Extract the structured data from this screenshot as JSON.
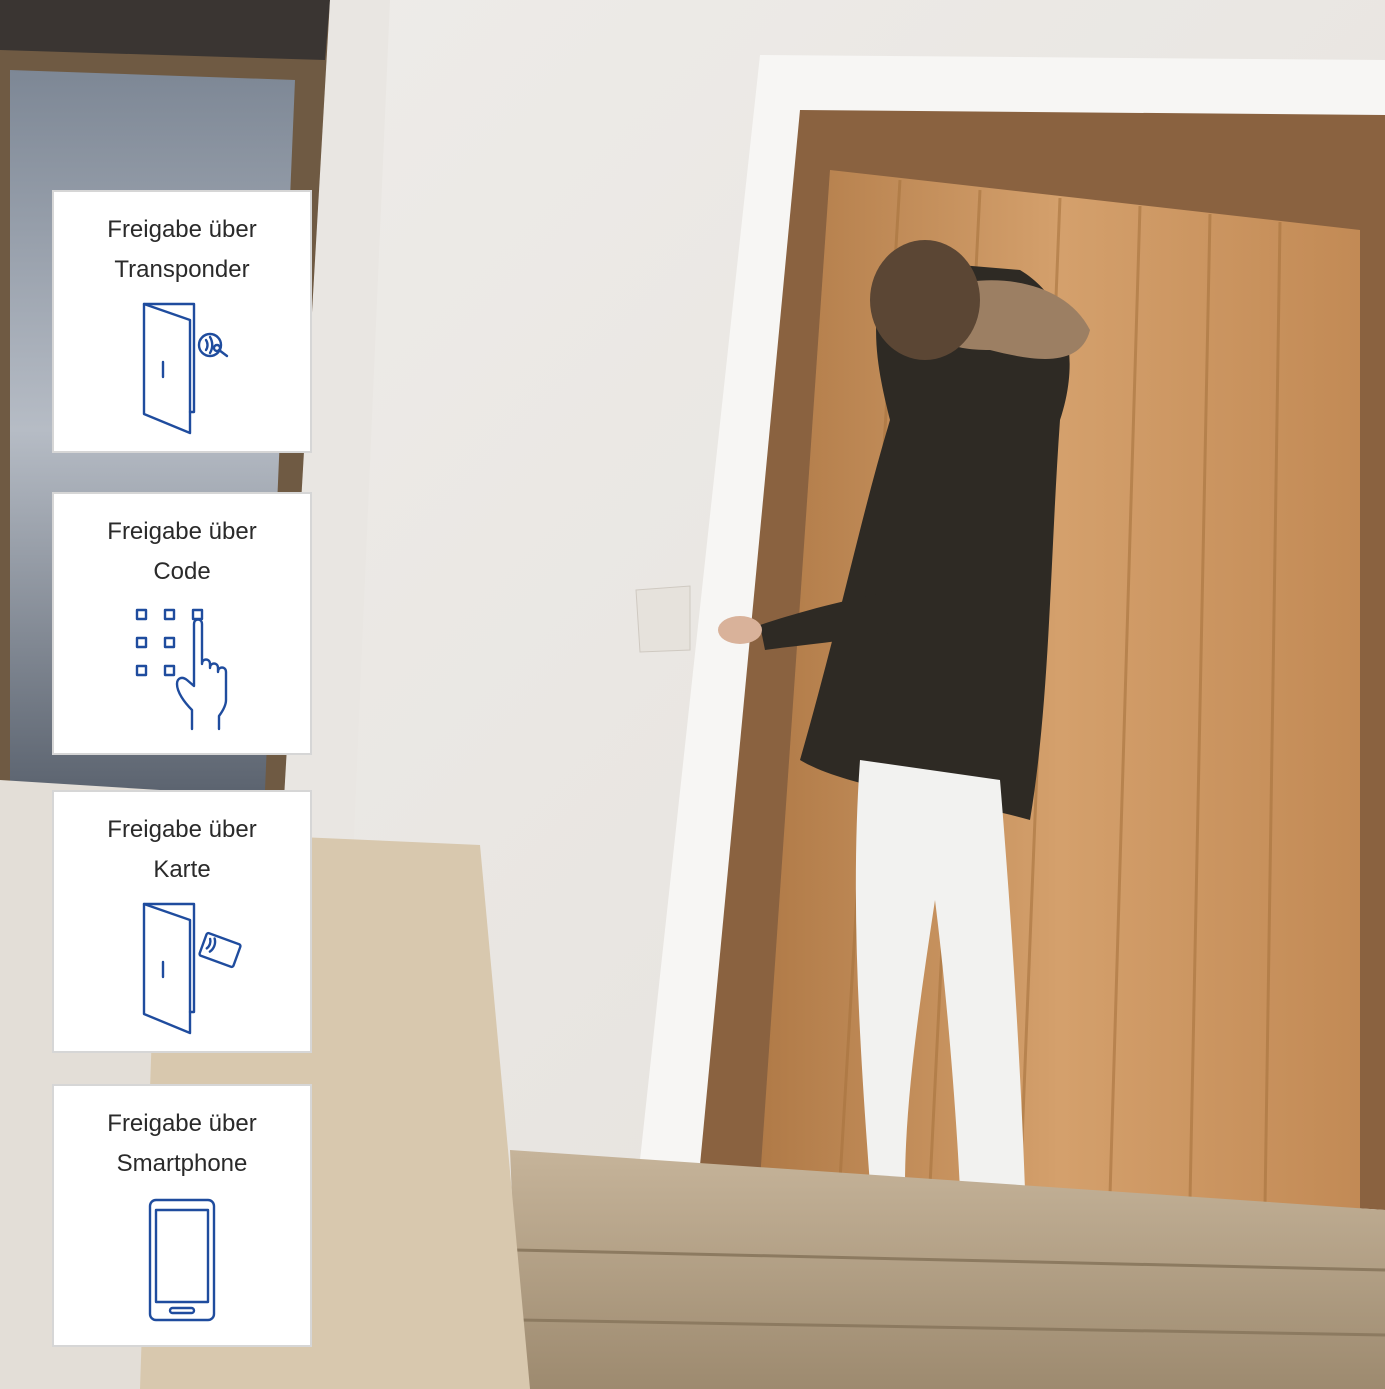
{
  "colors": {
    "icon_blue": "#1f4c9e",
    "card_border": "#d6d6d6",
    "wall": "#ece9e5",
    "door_wood": "#c9955f"
  },
  "cards": [
    {
      "line1": "Freigabe über",
      "line2": "Transponder",
      "icon": "door-transponder-icon"
    },
    {
      "line1": "Freigabe über",
      "line2": "Code",
      "icon": "keypad-finger-icon"
    },
    {
      "line1": "Freigabe über",
      "line2": "Karte",
      "icon": "door-card-icon"
    },
    {
      "line1": "Freigabe über",
      "line2": "Smartphone",
      "icon": "smartphone-icon"
    }
  ]
}
